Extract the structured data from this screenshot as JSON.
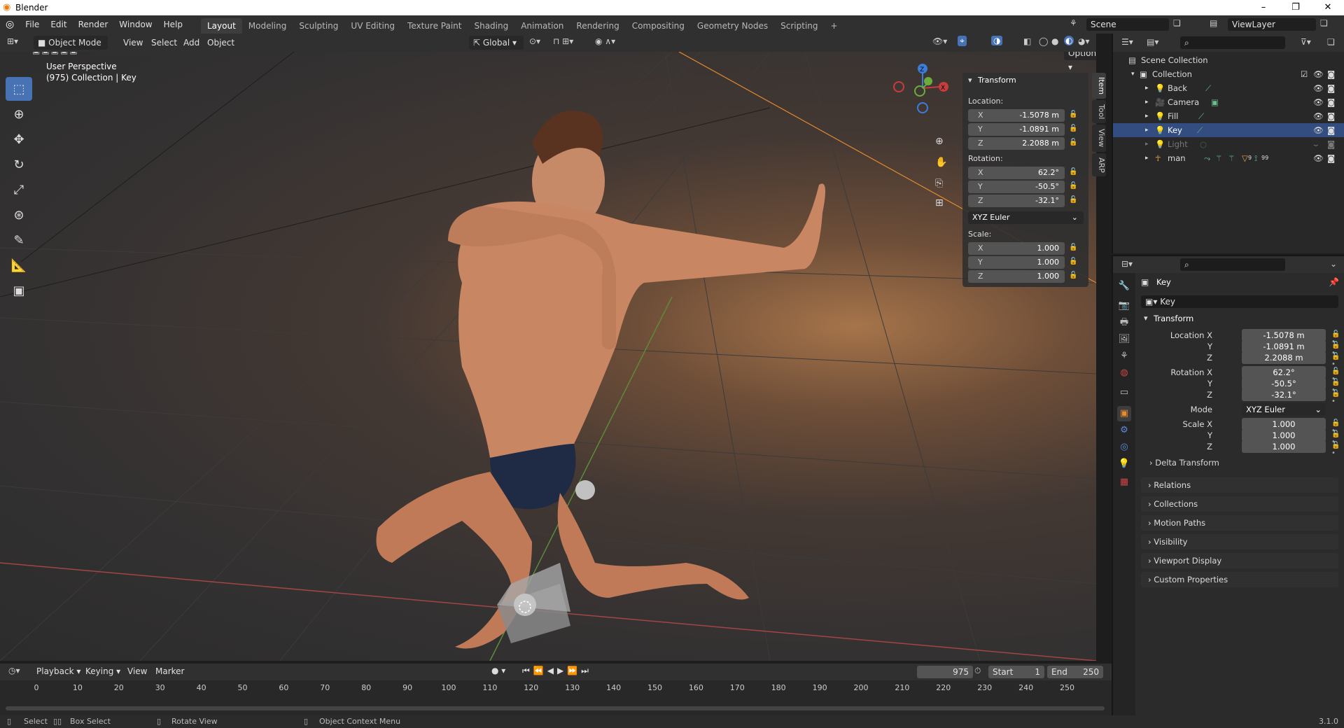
{
  "window": {
    "title": "Blender",
    "controls": [
      "–",
      "❐",
      "✕"
    ]
  },
  "top_menu": [
    "File",
    "Edit",
    "Render",
    "Window",
    "Help"
  ],
  "workspace_tabs": [
    {
      "label": "Layout",
      "active": true
    },
    {
      "label": "Modeling"
    },
    {
      "label": "Sculpting"
    },
    {
      "label": "UV Editing"
    },
    {
      "label": "Texture Paint"
    },
    {
      "label": "Shading"
    },
    {
      "label": "Animation"
    },
    {
      "label": "Rendering"
    },
    {
      "label": "Compositing"
    },
    {
      "label": "Geometry Nodes"
    },
    {
      "label": "Scripting"
    },
    {
      "label": "+"
    }
  ],
  "scene": {
    "name": "Scene",
    "view_layer": "ViewLayer"
  },
  "viewport_header": {
    "mode": "Object Mode",
    "menus": [
      "View",
      "Select",
      "Add",
      "Object"
    ],
    "orientation": "Global",
    "options": "Options"
  },
  "viewport": {
    "perspective": "User Perspective",
    "context": "(975) Collection | Key"
  },
  "toolbar": [
    "select-box",
    "cursor",
    "move",
    "rotate",
    "scale",
    "transform",
    "annotate",
    "measure",
    "add-cube"
  ],
  "npanel": {
    "title": "Transform",
    "location_label": "Location:",
    "location": [
      {
        "axis": "X",
        "value": "-1.5078 m"
      },
      {
        "axis": "Y",
        "value": "-1.0891 m"
      },
      {
        "axis": "Z",
        "value": "2.2088 m"
      }
    ],
    "rotation_label": "Rotation:",
    "rotation": [
      {
        "axis": "X",
        "value": "62.2°"
      },
      {
        "axis": "Y",
        "value": "-50.5°"
      },
      {
        "axis": "Z",
        "value": "-32.1°"
      }
    ],
    "rotation_mode": "XYZ Euler",
    "scale_label": "Scale:",
    "scale": [
      {
        "axis": "X",
        "value": "1.000"
      },
      {
        "axis": "Y",
        "value": "1.000"
      },
      {
        "axis": "Z",
        "value": "1.000"
      }
    ],
    "tabs": [
      "Item",
      "Tool",
      "View",
      "ARP"
    ]
  },
  "outliner": {
    "root": "Scene Collection",
    "collection": "Collection",
    "items": [
      {
        "name": "Back",
        "selected": false
      },
      {
        "name": "Camera",
        "selected": false
      },
      {
        "name": "Fill",
        "selected": false
      },
      {
        "name": "Key",
        "selected": true
      },
      {
        "name": "Light",
        "selected": false,
        "disabled": true
      },
      {
        "name": "man",
        "selected": false
      }
    ],
    "man_badges": [
      "9",
      "99"
    ]
  },
  "properties": {
    "object_name": "Key",
    "data_name": "Key",
    "section": "Transform",
    "location_x_label": "Location X",
    "rotation_x_label": "Rotation X",
    "mode_label": "Mode",
    "scale_x_label": "Scale X",
    "y_label": "Y",
    "z_label": "Z",
    "location": [
      "-1.5078 m",
      "-1.0891 m",
      "2.2088 m"
    ],
    "rotation": [
      "62.2°",
      "-50.5°",
      "-32.1°"
    ],
    "mode": "XYZ Euler",
    "scale": [
      "1.000",
      "1.000",
      "1.000"
    ],
    "subsections": [
      "Delta Transform",
      "Relations",
      "Collections",
      "Motion Paths",
      "Visibility",
      "Viewport Display",
      "Custom Properties"
    ]
  },
  "timeline": {
    "menus": [
      "Playback",
      "Keying",
      "View",
      "Marker"
    ],
    "current_frame": "975",
    "start_label": "Start",
    "start": "1",
    "end_label": "End",
    "end": "250",
    "ticks": [
      "0",
      "10",
      "20",
      "30",
      "40",
      "50",
      "60",
      "70",
      "80",
      "90",
      "100",
      "110",
      "120",
      "130",
      "140",
      "150",
      "160",
      "170",
      "180",
      "190",
      "200",
      "210",
      "220",
      "230",
      "240",
      "250"
    ]
  },
  "statusbar": {
    "items": [
      "Select",
      "Box Select",
      "Rotate View",
      "Object Context Menu"
    ],
    "version": "3.1.0"
  },
  "colors": {
    "accent": "#4772b3",
    "selection": "#334d80",
    "x_axis": "#c83c3c",
    "y_axis": "#6bac3c",
    "z_axis": "#3c7ddc"
  }
}
